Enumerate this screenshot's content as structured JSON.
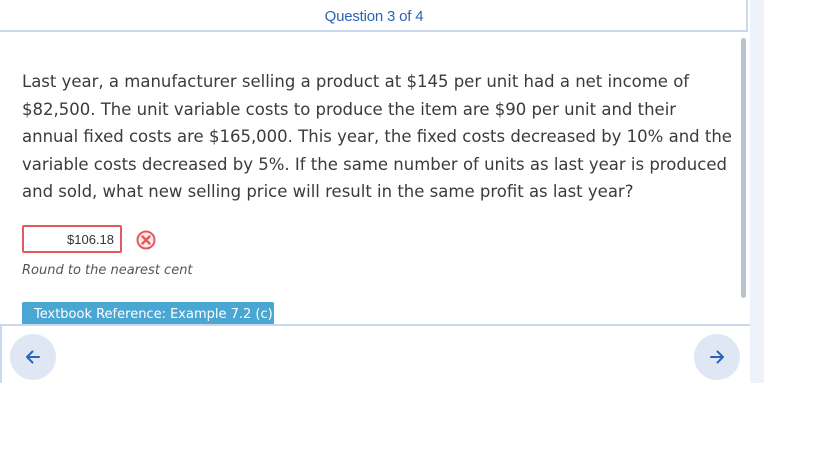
{
  "header": {
    "title": "Question 3 of 4"
  },
  "question": {
    "text": "Last year, a manufacturer selling a product at $145 per unit had a net income of $82,500. The unit variable costs to produce the item are $90 per unit and their annual fixed costs are $165,000. This year, the fixed costs decreased by 10% and the variable costs decreased by 5%. If the same number of units as last year is produced and sold, what new selling price will result in the same profit as last year?"
  },
  "answer": {
    "value": "$106.18",
    "status": "incorrect",
    "status_icon": "x-circle-icon",
    "hint": "Round to the nearest cent"
  },
  "reference": {
    "label": "Textbook Reference: Example 7.2 (c)"
  },
  "navigation": {
    "back_icon": "arrow-left-icon",
    "next_icon": "arrow-right-icon"
  },
  "colors": {
    "accent": "#2a64b8",
    "error": "#e35a5a",
    "button": "#4aa6d2",
    "nav_bg": "#dfe7f5"
  }
}
